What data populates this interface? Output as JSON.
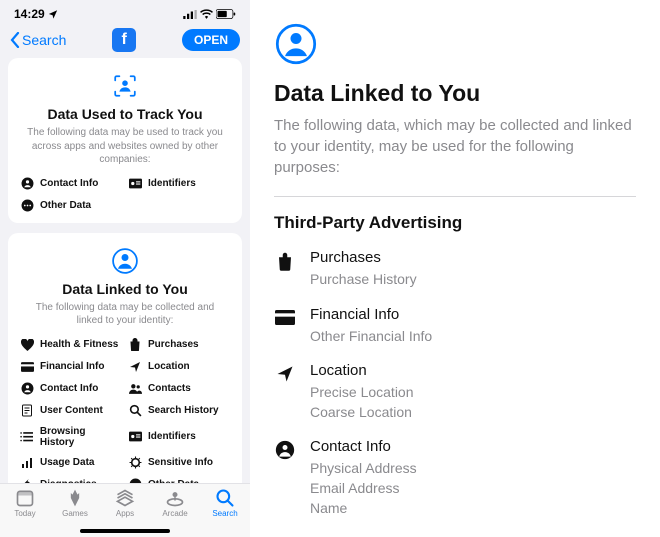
{
  "statusbar": {
    "time": "14:29"
  },
  "nav": {
    "back": "Search",
    "open": "OPEN"
  },
  "card_track": {
    "title": "Data Used to Track You",
    "sub": "The following data may be used to track you across apps and websites owned by other companies:",
    "items": [
      "Contact Info",
      "Identifiers",
      "Other Data"
    ]
  },
  "card_linked": {
    "title": "Data Linked to You",
    "sub": "The following data may be collected and linked to your identity:",
    "items": [
      "Health & Fitness",
      "Purchases",
      "Financial Info",
      "Location",
      "Contact Info",
      "Contacts",
      "User Content",
      "Search History",
      "Browsing History",
      "Identifiers",
      "Usage Data",
      "Sensitive Info",
      "Diagnostics",
      "Other Data"
    ]
  },
  "tabs": [
    "Today",
    "Games",
    "Apps",
    "Arcade",
    "Search"
  ],
  "detail": {
    "title": "Data Linked to You",
    "sub": "The following data, which may be collected and linked to your identity, may be used for the following purposes:",
    "section": "Third-Party Advertising",
    "rows": [
      {
        "title": "Purchases",
        "vals": [
          "Purchase History"
        ]
      },
      {
        "title": "Financial Info",
        "vals": [
          "Other Financial Info"
        ]
      },
      {
        "title": "Location",
        "vals": [
          "Precise Location",
          "Coarse Location"
        ]
      },
      {
        "title": "Contact Info",
        "vals": [
          "Physical Address",
          "Email Address",
          "Name"
        ]
      }
    ]
  }
}
